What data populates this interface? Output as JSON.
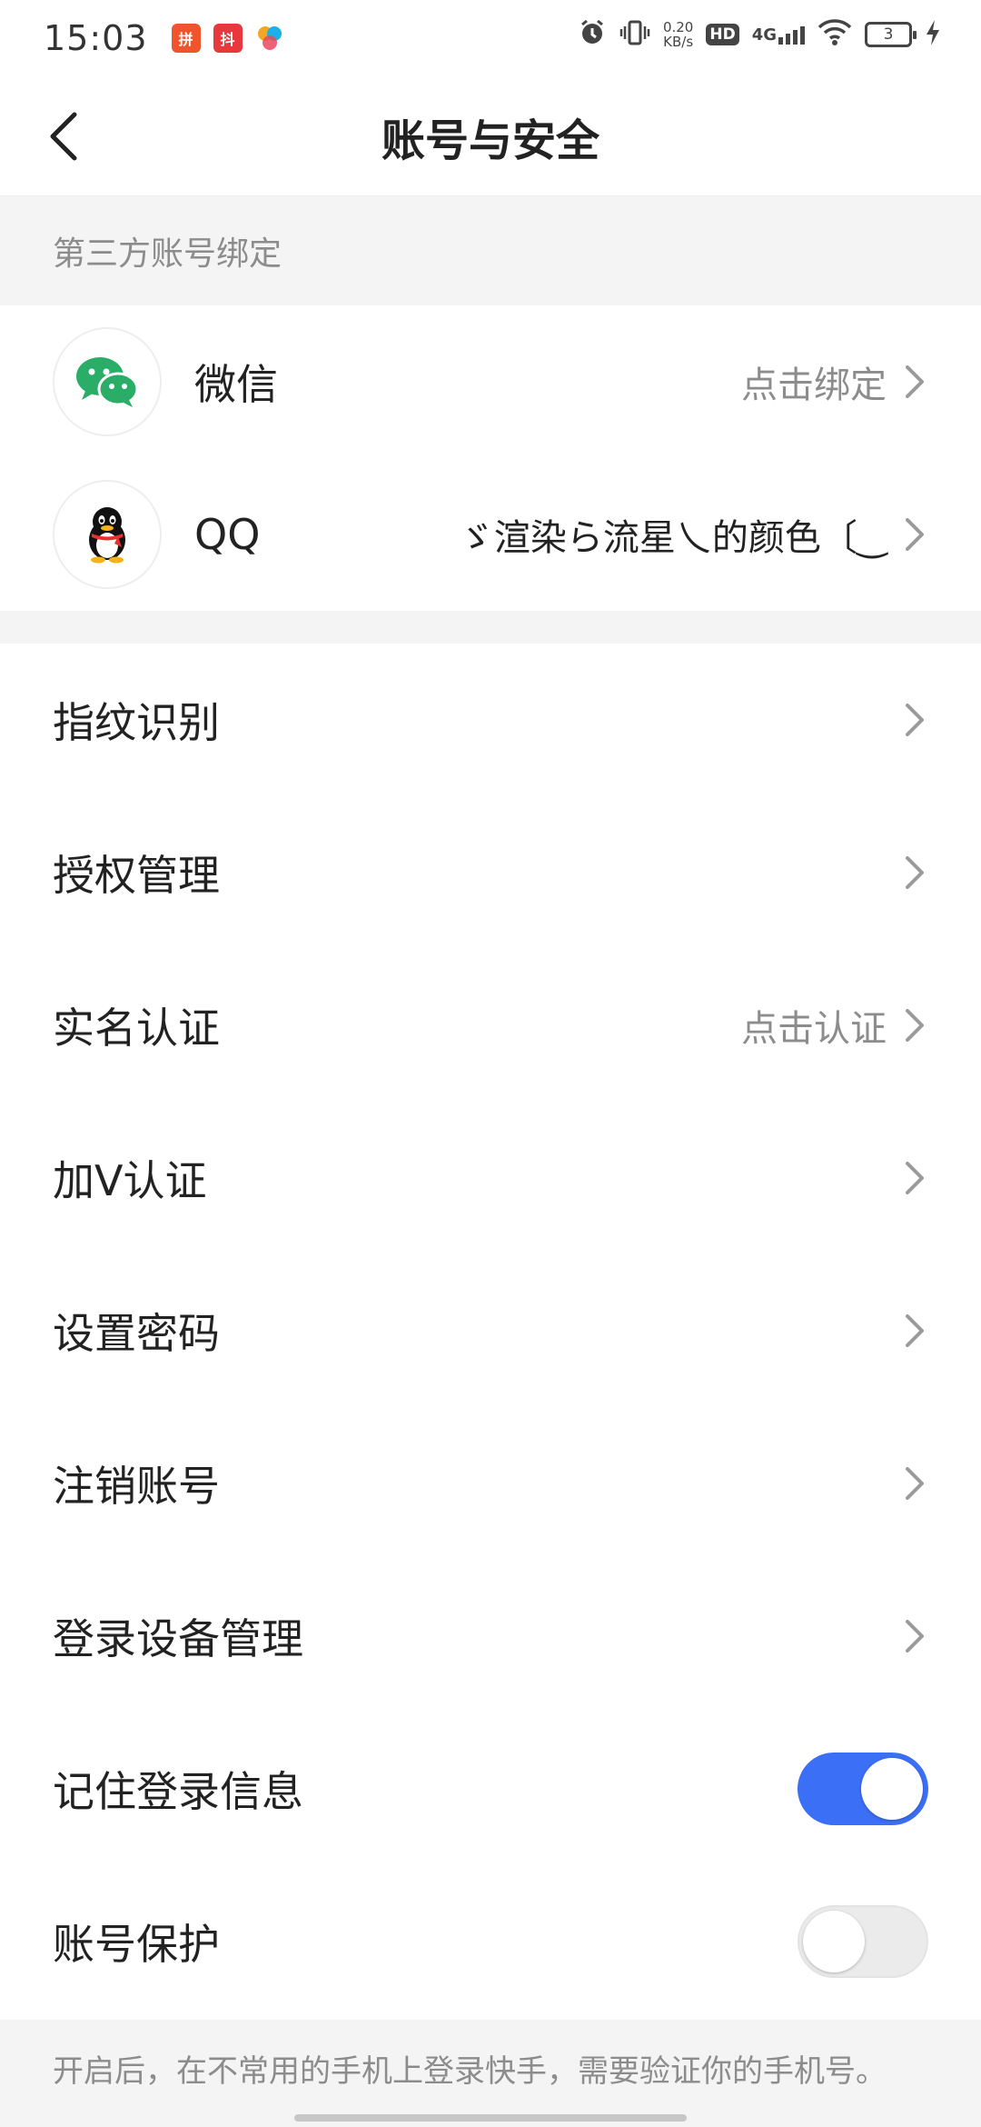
{
  "status_bar": {
    "time": "15:03",
    "net_speed": "0.20",
    "net_unit": "KB/s",
    "hd": "HD",
    "network": "4G",
    "battery": "3",
    "icons": [
      "app-icon-1",
      "app-icon-2",
      "app-icon-3",
      "alarm-icon",
      "vibrate-icon",
      "wifi-icon",
      "charging-icon"
    ]
  },
  "header": {
    "title": "账号与安全"
  },
  "third_party": {
    "section_title": "第三方账号绑定",
    "items": [
      {
        "label": "微信",
        "value": "点击绑定",
        "icon": "wechat-icon"
      },
      {
        "label": "QQ",
        "value": "ゞ渲染ら流星乀的颜色〔‿",
        "icon": "qq-icon"
      }
    ]
  },
  "menu": {
    "items": [
      {
        "label": "指纹识别",
        "value": ""
      },
      {
        "label": "授权管理",
        "value": ""
      },
      {
        "label": "实名认证",
        "value": "点击认证"
      },
      {
        "label": "加V认证",
        "value": ""
      },
      {
        "label": "设置密码",
        "value": ""
      },
      {
        "label": "注销账号",
        "value": ""
      },
      {
        "label": "登录设备管理",
        "value": ""
      }
    ]
  },
  "toggles": {
    "remember_login": {
      "label": "记住登录信息",
      "on": true
    },
    "account_protect": {
      "label": "账号保护",
      "on": false
    }
  },
  "footer": {
    "note": "开启后，在不常用的手机上登录快手，需要验证你的手机号。"
  },
  "colors": {
    "accent": "#3b6ff5",
    "secondary_text": "#8c8c8c",
    "section_bg": "#f4f4f4",
    "wechat_green": "#2aae67"
  }
}
